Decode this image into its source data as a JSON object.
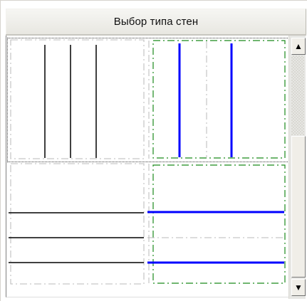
{
  "header": {
    "title": "Выбор типа стен"
  },
  "wall_type_options": [
    {
      "id": "vertical-thin-three-lines",
      "line_color": "#000000",
      "guide_color": "#b8b8b8"
    },
    {
      "id": "vertical-thick-two-lines",
      "line_color": "#0000ff",
      "guide_color": "#b8b8b8",
      "frame_color": "#1b8a1b"
    },
    {
      "id": "horizontal-thin-three-lines",
      "line_color": "#000000",
      "guide_color": "#b8b8b8"
    },
    {
      "id": "horizontal-thick-two-lines",
      "line_color": "#0000ff",
      "guide_color": "#b8b8b8",
      "frame_color": "#1b8a1b"
    }
  ],
  "scrollbar": {
    "up_arrow": "▲",
    "down_arrow": "▼"
  }
}
